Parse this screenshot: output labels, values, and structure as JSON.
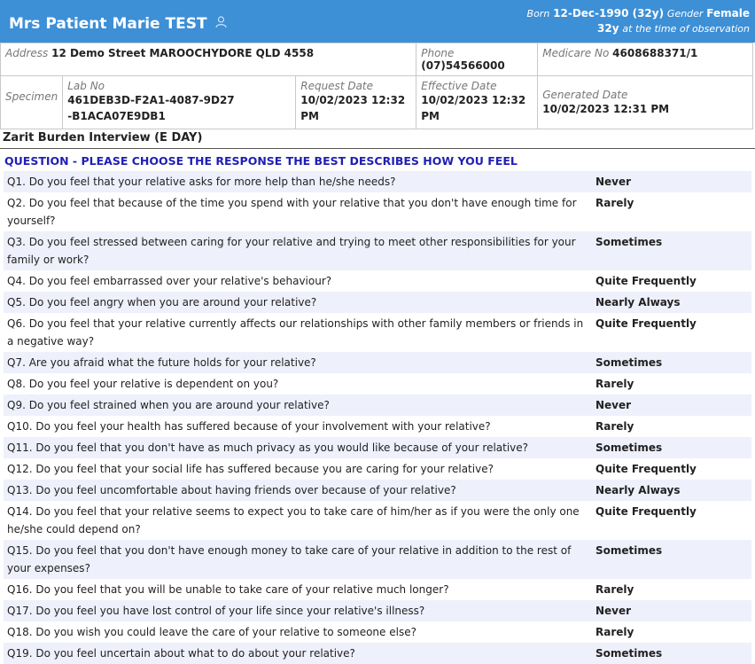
{
  "patient": {
    "name": "Mrs Patient Marie TEST",
    "born_label": "Born",
    "dob": "12-Dec-1990 (32y)",
    "gender_label": "Gender",
    "gender": "Female",
    "age": "32y",
    "age_note": "at the time of observation"
  },
  "info": {
    "address_label": "Address",
    "address": "12 Demo Street MAROOCHYDORE QLD 4558",
    "phone_label": "Phone",
    "phone": "(07)54566000",
    "medicare_label": "Medicare No",
    "medicare": "4608688371/1",
    "specimen_label": "Specimen",
    "lab_label": "Lab No",
    "lab_no": "461DEB3D-F2A1-4087-9D27-B1ACA07E9DB1",
    "request_label": "Request Date",
    "request_date": "10/02/2023 12:32 PM",
    "effective_label": "Effective Date",
    "effective_date": "10/02/2023 12:32 PM",
    "generated_label": "Generated Date",
    "generated_date": "10/02/2023 12:31 PM"
  },
  "form": {
    "title": "Zarit Burden Interview (E DAY)",
    "question_header": "QUESTION - PLEASE CHOOSE THE RESPONSE THE BEST DESCRIBES HOW YOU FEEL",
    "rows": [
      {
        "q": "Q1. Do you feel that your relative asks for more help than he/she needs?",
        "a": "Never"
      },
      {
        "q": "Q2. Do you feel that because of the time you spend with your relative that you don't have enough time for yourself?",
        "a": "Rarely"
      },
      {
        "q": "Q3. Do you feel stressed between caring for your relative and trying to meet other responsibilities for your family or work?",
        "a": "Sometimes"
      },
      {
        "q": "Q4. Do you feel embarrassed over your relative's behaviour?",
        "a": "Quite Frequently"
      },
      {
        "q": "Q5. Do you feel angry when you are around your relative?",
        "a": "Nearly Always"
      },
      {
        "q": "Q6. Do you feel that your relative currently affects our relationships with other family members or friends in a negative way?",
        "a": "Quite Frequently"
      },
      {
        "q": "Q7. Are you afraid what the future holds for your relative?",
        "a": "Sometimes"
      },
      {
        "q": "Q8. Do you feel your relative is dependent on you?",
        "a": "Rarely"
      },
      {
        "q": "Q9. Do you feel strained when you are around your relative?",
        "a": "Never"
      },
      {
        "q": "Q10. Do you feel your health has suffered because of your involvement with your relative?",
        "a": "Rarely"
      },
      {
        "q": "Q11. Do you feel that you don't have as much privacy as you would like because of your relative?",
        "a": "Sometimes"
      },
      {
        "q": "Q12. Do you feel that your social life has suffered because you are caring for your relative?",
        "a": "Quite Frequently"
      },
      {
        "q": "Q13. Do you feel uncomfortable about having friends over because of your relative?",
        "a": "Nearly Always"
      },
      {
        "q": "Q14. Do you feel that your relative seems to expect you to take care of him/her as if you were the only one he/she could depend on?",
        "a": "Quite Frequently"
      },
      {
        "q": "Q15. Do you feel that you don't have enough money to take care of your relative in addition to the rest of your expenses?",
        "a": "Sometimes"
      },
      {
        "q": "Q16. Do you feel that you will be unable to take care of your relative much longer?",
        "a": "Rarely"
      },
      {
        "q": "Q17. Do you feel you have lost control of your life since your relative's illness?",
        "a": "Never"
      },
      {
        "q": "Q18. Do you wish you could leave the care of your relative to someone else?",
        "a": "Rarely"
      },
      {
        "q": "Q19. Do you feel uncertain about what to do about your relative?",
        "a": "Sometimes"
      }
    ]
  }
}
